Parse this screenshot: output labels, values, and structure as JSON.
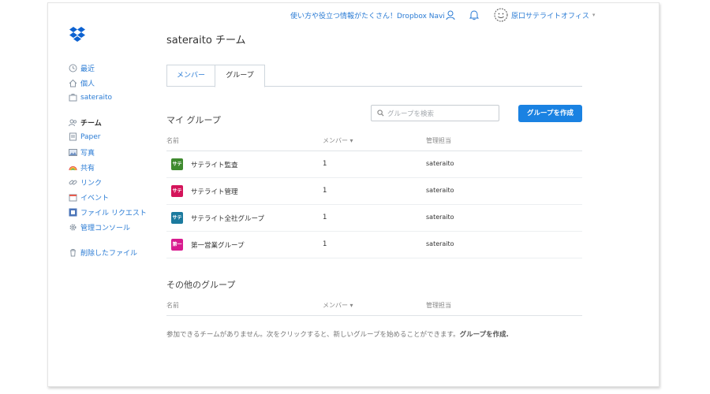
{
  "topbar": {
    "info_link": "使い方や役立つ情報がたくさん！Dropbox Navi",
    "account_name": "原口サテライトオフィス",
    "user_icon": "user-icon",
    "bell_icon": "bell-icon",
    "avatar_icon": "smiley-avatar-icon"
  },
  "page": {
    "title": "sateraito チーム"
  },
  "sidebar": {
    "items": [
      {
        "label": "最近",
        "icon": "clock-icon"
      },
      {
        "label": "個人",
        "icon": "home-icon"
      },
      {
        "label": "sateraito",
        "icon": "briefcase-icon"
      },
      {
        "label": "チーム",
        "icon": "people-icon"
      },
      {
        "label": "Paper",
        "icon": "paper-icon"
      },
      {
        "label": "写真",
        "icon": "photo-icon"
      },
      {
        "label": "共有",
        "icon": "rainbow-icon"
      },
      {
        "label": "リンク",
        "icon": "link-icon"
      },
      {
        "label": "イベント",
        "icon": "calendar-icon"
      },
      {
        "label": "ファイル リクエスト",
        "icon": "file-request-icon"
      },
      {
        "label": "管理コンソール",
        "icon": "gear-icon"
      },
      {
        "label": "削除したファイル",
        "icon": "trash-icon"
      }
    ]
  },
  "tabs": {
    "members": "メンバー",
    "groups": "グループ"
  },
  "my_groups": {
    "title": "マイ グループ",
    "search_placeholder": "グループを検索",
    "create_button": "グループを作成",
    "columns": {
      "name": "名前",
      "members": "メンバー ▾",
      "manager": "管理担当"
    },
    "rows": [
      {
        "badge": "サテ",
        "badge_color": "#3f8a2f",
        "name": "サテライト監査",
        "count": "1",
        "manager": "sateraito"
      },
      {
        "badge": "サテ",
        "badge_color": "#d4145a",
        "name": "サテライト管理",
        "count": "1",
        "manager": "sateraito"
      },
      {
        "badge": "サテ",
        "badge_color": "#1b7a9e",
        "name": "サテライト全社グループ",
        "count": "1",
        "manager": "sateraito"
      },
      {
        "badge": "第一",
        "badge_color": "#d81b8f",
        "name": "第一営業グループ",
        "count": "1",
        "manager": "sateraito"
      }
    ]
  },
  "other_groups": {
    "title": "その他のグループ",
    "columns": {
      "name": "名前",
      "members": "メンバー ▾",
      "manager": "管理担当"
    },
    "empty_message": "参加できるチームがありません。次をクリックすると、新しいグループを始めることができます。",
    "empty_link": "グループを作成."
  },
  "colors": {
    "accent": "#1a82e2",
    "link": "#2a7bd4"
  }
}
